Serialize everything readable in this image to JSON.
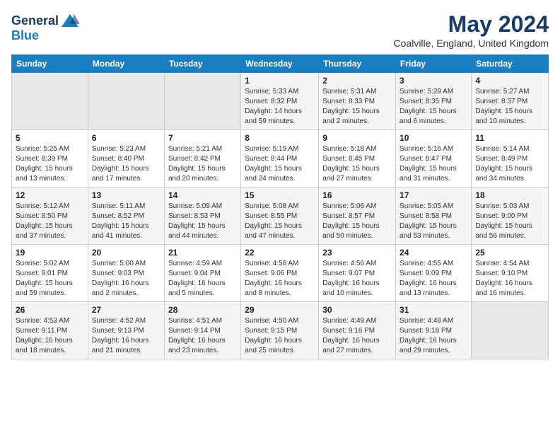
{
  "header": {
    "logo_line1": "General",
    "logo_line2": "Blue",
    "month": "May 2024",
    "location": "Coalville, England, United Kingdom"
  },
  "weekdays": [
    "Sunday",
    "Monday",
    "Tuesday",
    "Wednesday",
    "Thursday",
    "Friday",
    "Saturday"
  ],
  "weeks": [
    [
      {
        "day": "",
        "info": ""
      },
      {
        "day": "",
        "info": ""
      },
      {
        "day": "",
        "info": ""
      },
      {
        "day": "1",
        "info": "Sunrise: 5:33 AM\nSunset: 8:32 PM\nDaylight: 14 hours and 59 minutes."
      },
      {
        "day": "2",
        "info": "Sunrise: 5:31 AM\nSunset: 8:33 PM\nDaylight: 15 hours and 2 minutes."
      },
      {
        "day": "3",
        "info": "Sunrise: 5:29 AM\nSunset: 8:35 PM\nDaylight: 15 hours and 6 minutes."
      },
      {
        "day": "4",
        "info": "Sunrise: 5:27 AM\nSunset: 8:37 PM\nDaylight: 15 hours and 10 minutes."
      }
    ],
    [
      {
        "day": "5",
        "info": "Sunrise: 5:25 AM\nSunset: 8:39 PM\nDaylight: 15 hours and 13 minutes."
      },
      {
        "day": "6",
        "info": "Sunrise: 5:23 AM\nSunset: 8:40 PM\nDaylight: 15 hours and 17 minutes."
      },
      {
        "day": "7",
        "info": "Sunrise: 5:21 AM\nSunset: 8:42 PM\nDaylight: 15 hours and 20 minutes."
      },
      {
        "day": "8",
        "info": "Sunrise: 5:19 AM\nSunset: 8:44 PM\nDaylight: 15 hours and 24 minutes."
      },
      {
        "day": "9",
        "info": "Sunrise: 5:18 AM\nSunset: 8:45 PM\nDaylight: 15 hours and 27 minutes."
      },
      {
        "day": "10",
        "info": "Sunrise: 5:16 AM\nSunset: 8:47 PM\nDaylight: 15 hours and 31 minutes."
      },
      {
        "day": "11",
        "info": "Sunrise: 5:14 AM\nSunset: 8:49 PM\nDaylight: 15 hours and 34 minutes."
      }
    ],
    [
      {
        "day": "12",
        "info": "Sunrise: 5:12 AM\nSunset: 8:50 PM\nDaylight: 15 hours and 37 minutes."
      },
      {
        "day": "13",
        "info": "Sunrise: 5:11 AM\nSunset: 8:52 PM\nDaylight: 15 hours and 41 minutes."
      },
      {
        "day": "14",
        "info": "Sunrise: 5:09 AM\nSunset: 8:53 PM\nDaylight: 15 hours and 44 minutes."
      },
      {
        "day": "15",
        "info": "Sunrise: 5:08 AM\nSunset: 8:55 PM\nDaylight: 15 hours and 47 minutes."
      },
      {
        "day": "16",
        "info": "Sunrise: 5:06 AM\nSunset: 8:57 PM\nDaylight: 15 hours and 50 minutes."
      },
      {
        "day": "17",
        "info": "Sunrise: 5:05 AM\nSunset: 8:58 PM\nDaylight: 15 hours and 53 minutes."
      },
      {
        "day": "18",
        "info": "Sunrise: 5:03 AM\nSunset: 9:00 PM\nDaylight: 15 hours and 56 minutes."
      }
    ],
    [
      {
        "day": "19",
        "info": "Sunrise: 5:02 AM\nSunset: 9:01 PM\nDaylight: 15 hours and 59 minutes."
      },
      {
        "day": "20",
        "info": "Sunrise: 5:00 AM\nSunset: 9:03 PM\nDaylight: 16 hours and 2 minutes."
      },
      {
        "day": "21",
        "info": "Sunrise: 4:59 AM\nSunset: 9:04 PM\nDaylight: 16 hours and 5 minutes."
      },
      {
        "day": "22",
        "info": "Sunrise: 4:58 AM\nSunset: 9:06 PM\nDaylight: 16 hours and 8 minutes."
      },
      {
        "day": "23",
        "info": "Sunrise: 4:56 AM\nSunset: 9:07 PM\nDaylight: 16 hours and 10 minutes."
      },
      {
        "day": "24",
        "info": "Sunrise: 4:55 AM\nSunset: 9:09 PM\nDaylight: 16 hours and 13 minutes."
      },
      {
        "day": "25",
        "info": "Sunrise: 4:54 AM\nSunset: 9:10 PM\nDaylight: 16 hours and 16 minutes."
      }
    ],
    [
      {
        "day": "26",
        "info": "Sunrise: 4:53 AM\nSunset: 9:11 PM\nDaylight: 16 hours and 18 minutes."
      },
      {
        "day": "27",
        "info": "Sunrise: 4:52 AM\nSunset: 9:13 PM\nDaylight: 16 hours and 21 minutes."
      },
      {
        "day": "28",
        "info": "Sunrise: 4:51 AM\nSunset: 9:14 PM\nDaylight: 16 hours and 23 minutes."
      },
      {
        "day": "29",
        "info": "Sunrise: 4:50 AM\nSunset: 9:15 PM\nDaylight: 16 hours and 25 minutes."
      },
      {
        "day": "30",
        "info": "Sunrise: 4:49 AM\nSunset: 9:16 PM\nDaylight: 16 hours and 27 minutes."
      },
      {
        "day": "31",
        "info": "Sunrise: 4:48 AM\nSunset: 9:18 PM\nDaylight: 16 hours and 29 minutes."
      },
      {
        "day": "",
        "info": ""
      }
    ]
  ]
}
